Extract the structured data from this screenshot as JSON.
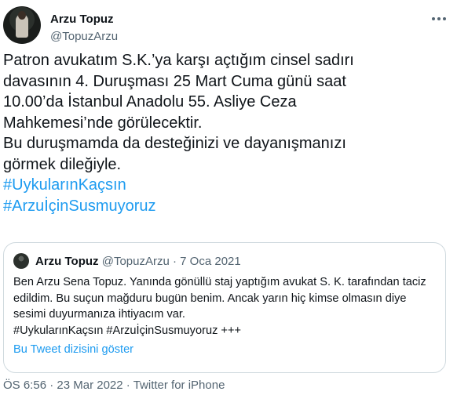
{
  "author": {
    "name": "Arzu Topuz",
    "handle": "@TopuzArzu"
  },
  "tweet": {
    "lines": [
      "Patron avukatım S.K.’ya karşı açtığım cinsel sadırı",
      "davasının 4. Duruşması 25 Mart Cuma günü saat",
      "10.00’da İstanbul Anadolu 55. Asliye Ceza",
      "Mahkemesi’nde görülecektir.",
      "Bu duruşmamda da desteğinizi ve dayanışmanızı",
      "görmek dileğiyle."
    ],
    "hashtags": [
      "#UykularınKaçsın",
      "#ArzuİçinSusmuyoruz"
    ]
  },
  "quoted_tweet": {
    "name": "Arzu Topuz",
    "handle": "@TopuzArzu",
    "separator": "·",
    "date": "7 Oca 2021",
    "lines": [
      "Ben Arzu Sena Topuz. Yanında gönüllü staj yaptığım avukat S. K. tarafından taciz",
      "edildim. Bu suçun mağduru bugün benim. Ancak yarın hiç kimse olmasın diye",
      "sesimi duyurmanıza ihtiyacım var.",
      "#UykularınKaçsın #ArzuİçinSusmuyoruz  +++"
    ],
    "thread_link": "Bu Tweet dizisini göster"
  },
  "footer": {
    "time": "ÖS 6:56",
    "separator1": "·",
    "date": "23 Mar 2022",
    "separator2": "·",
    "source": "Twitter for iPhone"
  },
  "icons": {
    "more": "more-horizontal-icon"
  },
  "colors": {
    "text": "#0f1419",
    "secondary": "#536471",
    "link": "#1d9bf0",
    "border": "#cfd9de"
  }
}
